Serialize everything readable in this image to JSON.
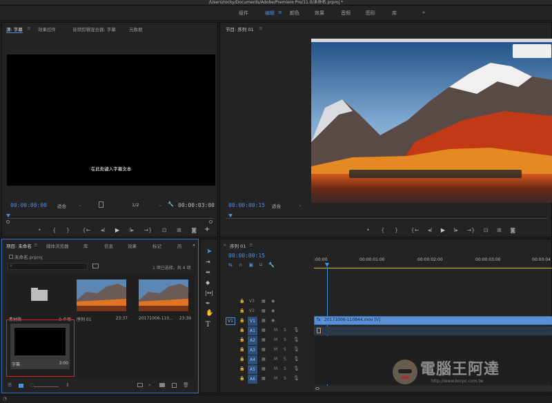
{
  "window_title": "/Users/rocky/Documents/Adobe/Premiere Pro/11.0/未命名.prproj *",
  "workspaces": [
    "组件",
    "编辑",
    "颜色",
    "效果",
    "音频",
    "图形",
    "库"
  ],
  "more_glyph": "»",
  "source_panel": {
    "tabs": [
      "源: 字幕",
      "效果控件",
      "音频剪辑混合器: 字幕",
      "元数据"
    ],
    "caption_text": "在此处键入字幕文本",
    "timecode_in": "00:00:00:00",
    "fit": "适合",
    "resolution": "1/2",
    "timecode_out": "00:00:03:00"
  },
  "program_panel": {
    "title": "节目: 序列 01",
    "timecode": "00:00:00:15",
    "fit": "适合"
  },
  "project_panel": {
    "tabs": [
      "项目: 未命名",
      "媒体浏览器",
      "库",
      "信息",
      "效果",
      "标记",
      "历"
    ],
    "filename": "未命名.prproj",
    "selection": "1 项已选择，共 4 项",
    "items": [
      {
        "name": "素材箱",
        "meta": "0 个项",
        "type": "bin"
      },
      {
        "name": "序列 01",
        "meta": "23:37",
        "type": "sequence"
      },
      {
        "name": "20171006-110...",
        "meta": "23:39",
        "type": "clip"
      },
      {
        "name": "字幕",
        "meta": "3:00",
        "type": "caption"
      }
    ]
  },
  "timeline_panel": {
    "title": "序列 01",
    "timecode": "00:00:00:15",
    "ruler": [
      ":00:00",
      "00:00:01:00",
      "00:00:02:00",
      "00:00:03:00",
      "00:00:04"
    ],
    "video_tracks": [
      "V3",
      "V2",
      "V1"
    ],
    "audio_tracks": [
      "A1",
      "A2",
      "A3",
      "A4",
      "A5",
      "A6"
    ],
    "source_patch": "V1",
    "clip_label": "20171006-110844.mov [V]"
  },
  "watermark": {
    "text": "電腦王阿達",
    "url": "http://www.kocpc.com.tw"
  }
}
